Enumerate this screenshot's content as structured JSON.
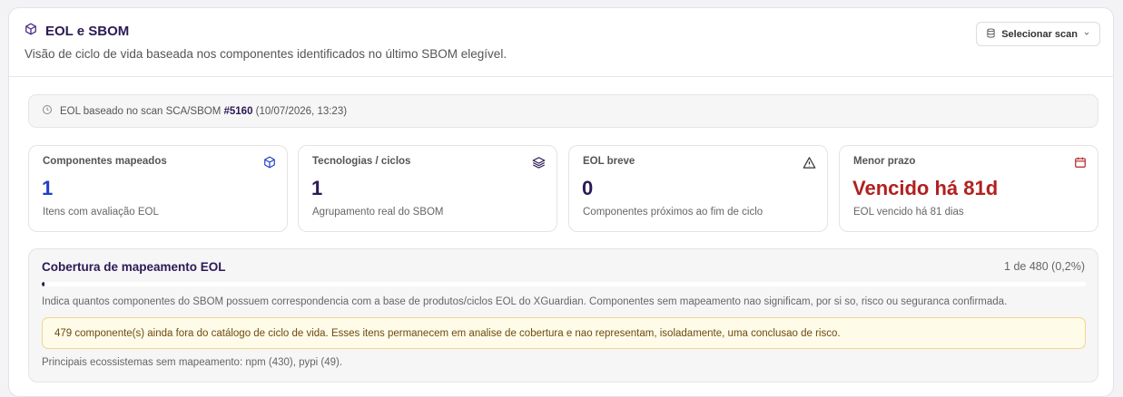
{
  "header": {
    "title": "EOL e SBOM",
    "subtitle": "Visão de ciclo de vida baseada nos componentes identificados no último SBOM elegível.",
    "scan_button": "Selecionar scan"
  },
  "info": {
    "prefix": "EOL baseado no scan SCA/SBOM",
    "scan_id": "#5160",
    "date": "(10/07/2026, 13:23)"
  },
  "stats": [
    {
      "label": "Componentes mapeados",
      "value": "1",
      "desc": "Itens com avaliação EOL",
      "icon": "box-icon"
    },
    {
      "label": "Tecnologias / ciclos",
      "value": "1",
      "desc": "Agrupamento real do SBOM",
      "icon": "layers-icon"
    },
    {
      "label": "EOL breve",
      "value": "0",
      "desc": "Componentes próximos ao fim de ciclo",
      "icon": "warning-icon"
    },
    {
      "label": "Menor prazo",
      "value": "Vencido há 81d",
      "desc": "EOL vencido há 81 dias",
      "icon": "calendar-icon"
    }
  ],
  "coverage": {
    "title": "Cobertura de mapeamento EOL",
    "count": "1 de 480 (0,2%)",
    "progress": 0.002,
    "note": "Indica quantos componentes do SBOM possuem correspondencia com a base de produtos/ciclos EOL do XGuardian. Componentes sem mapeamento nao significam, por si so, risco ou seguranca confirmada.",
    "warning": "479 componente(s) ainda fora do catálogo de ciclo de vida. Esses itens permanecem em analise de cobertura e nao representam, isoladamente, uma conclusao de risco.",
    "ecosystems": "Principais ecossistemas sem mapeamento: npm (430), pypi (49)."
  },
  "colors": {
    "accent": "#2b1a55",
    "blue": "#1f3fc7",
    "danger": "#b2201f",
    "warning_bg": "#fffbe9"
  }
}
